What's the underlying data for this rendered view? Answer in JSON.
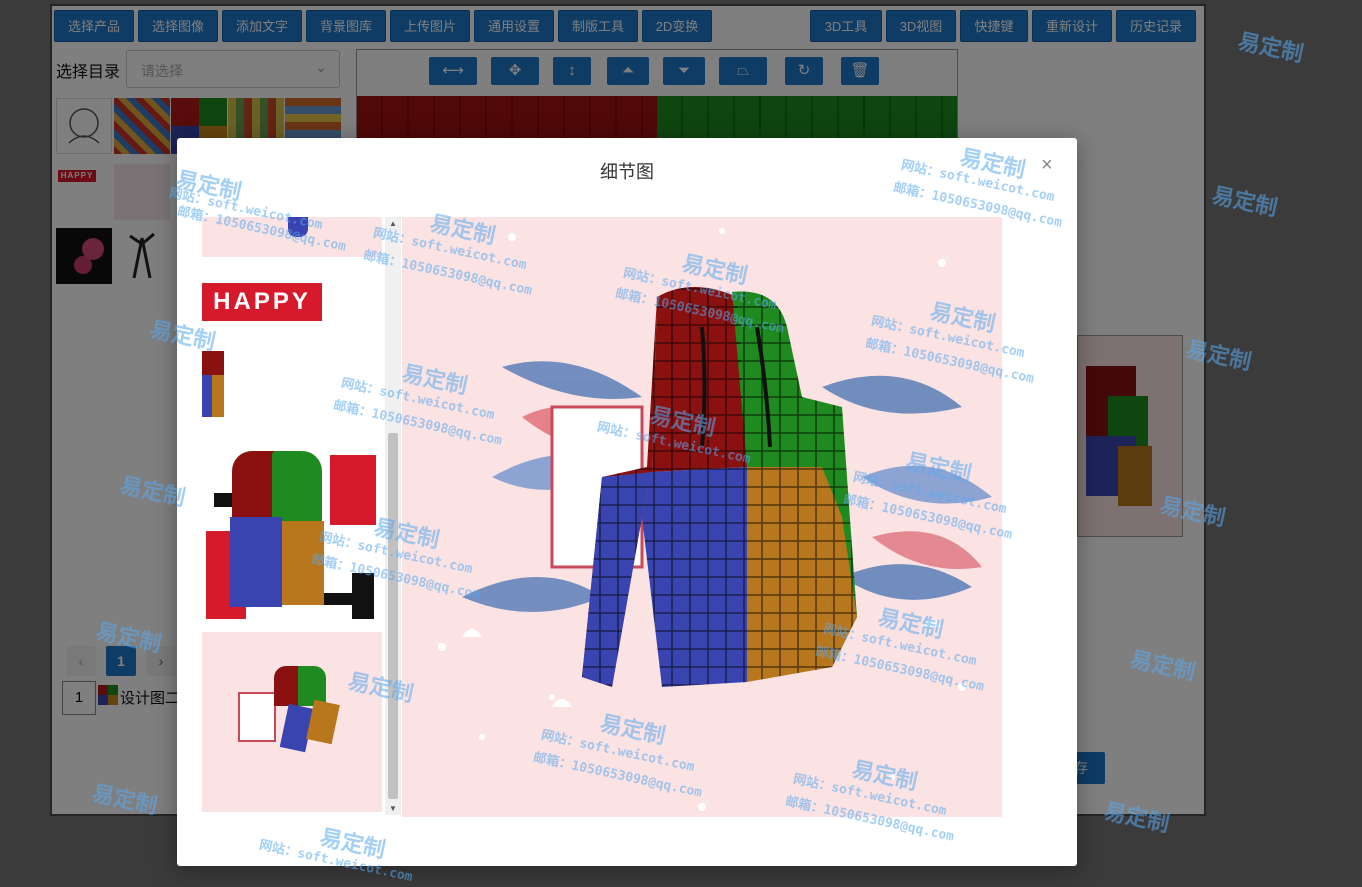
{
  "toolbar": {
    "left_buttons": [
      "选择产品",
      "选择图像",
      "添加文字",
      "背景图库",
      "上传图片",
      "通用设置",
      "制版工具",
      "2D变换"
    ],
    "right_buttons": [
      "3D工具",
      "3D视图",
      "快捷键",
      "重新设计",
      "历史记录"
    ]
  },
  "directory": {
    "label": "选择目录",
    "placeholder": "请选择"
  },
  "thumb_overlays": {
    "happy_small": "HAPPY"
  },
  "pagination": {
    "prev": "‹",
    "current": "1",
    "next": "›"
  },
  "design_row": {
    "index": "1",
    "name": "设计图二"
  },
  "save_button": "存",
  "modal": {
    "title": "细节图",
    "close": "×",
    "happy_text": "HAPPY"
  },
  "watermark": {
    "brand": "易定制",
    "site": "网站：soft.weicot.com",
    "email": "邮箱：1050653098@qq.com"
  },
  "colors": {
    "primary_button": "#1f78c8",
    "overlay": "rgba(0,0,0,0.5)",
    "preview_bg": "#fbe3e3",
    "happy_red": "#d7192c",
    "hoodie_red": "#8b1111",
    "hoodie_green": "#1f8a1f",
    "hoodie_blue": "#3a44b0",
    "hoodie_orange": "#b8761d"
  },
  "icons": [
    "swap-horizontal-icon",
    "move-icon",
    "swap-vertical-icon",
    "align-top-icon",
    "align-bottom-icon",
    "perspective-icon",
    "rotate-icon",
    "trash-icon",
    "close-icon",
    "chevron-down-icon",
    "scroll-up-icon",
    "scroll-down-icon"
  ]
}
